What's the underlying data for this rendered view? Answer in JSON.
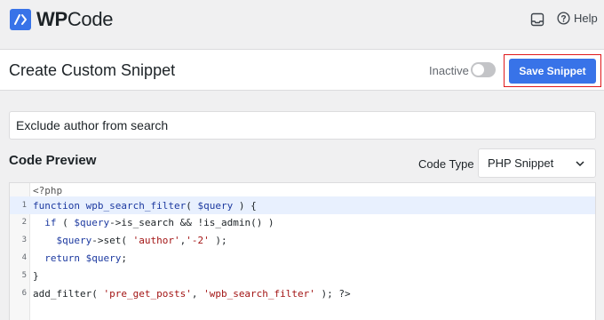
{
  "topbar": {
    "logo_wp": "WP",
    "logo_code": "Code",
    "help_label": "Help"
  },
  "header": {
    "page_title": "Create Custom Snippet",
    "status_label": "Inactive",
    "active": false,
    "save_label": "Save Snippet"
  },
  "snippet": {
    "title_value": "Exclude author from search"
  },
  "code_preview": {
    "section_title": "Code Preview",
    "code_type_label": "Code Type",
    "code_type_value": "PHP Snippet",
    "lines": [
      {
        "number": "",
        "tokens": [
          {
            "t": "tag",
            "v": "<?php"
          }
        ]
      },
      {
        "number": "1",
        "active": true,
        "tokens": [
          {
            "t": "kw",
            "v": "function"
          },
          {
            "t": "plain",
            "v": " "
          },
          {
            "t": "fn",
            "v": "wpb_search_filter"
          },
          {
            "t": "plain",
            "v": "( "
          },
          {
            "t": "var",
            "v": "$query"
          },
          {
            "t": "plain",
            "v": " ) {"
          }
        ]
      },
      {
        "number": "2",
        "tokens": [
          {
            "t": "plain",
            "v": "  "
          },
          {
            "t": "kw",
            "v": "if"
          },
          {
            "t": "plain",
            "v": " ( "
          },
          {
            "t": "var",
            "v": "$query"
          },
          {
            "t": "plain",
            "v": "->is_search && !is_admin() )"
          }
        ]
      },
      {
        "number": "3",
        "tokens": [
          {
            "t": "plain",
            "v": "    "
          },
          {
            "t": "var",
            "v": "$query"
          },
          {
            "t": "plain",
            "v": "->set( "
          },
          {
            "t": "str",
            "v": "'author'"
          },
          {
            "t": "plain",
            "v": ","
          },
          {
            "t": "str",
            "v": "'-2'"
          },
          {
            "t": "plain",
            "v": " );"
          }
        ]
      },
      {
        "number": "4",
        "tokens": [
          {
            "t": "plain",
            "v": "  "
          },
          {
            "t": "kw",
            "v": "return"
          },
          {
            "t": "plain",
            "v": " "
          },
          {
            "t": "var",
            "v": "$query"
          },
          {
            "t": "plain",
            "v": ";"
          }
        ]
      },
      {
        "number": "5",
        "tokens": [
          {
            "t": "plain",
            "v": "}"
          }
        ]
      },
      {
        "number": "6",
        "tokens": [
          {
            "t": "plain",
            "v": "add_filter( "
          },
          {
            "t": "str",
            "v": "'pre_get_posts'"
          },
          {
            "t": "plain",
            "v": ", "
          },
          {
            "t": "str",
            "v": "'wpb_search_filter'"
          },
          {
            "t": "plain",
            "v": " ); ?>"
          }
        ]
      }
    ]
  },
  "colors": {
    "accent": "#3873e8",
    "highlight_border": "#e0181b"
  }
}
